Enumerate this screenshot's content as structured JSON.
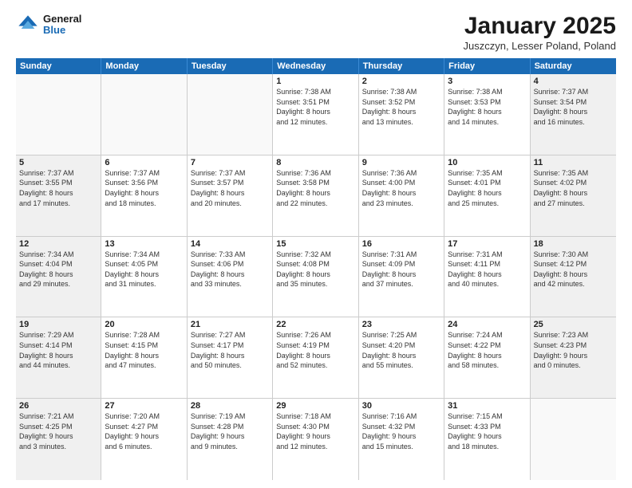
{
  "header": {
    "logo_line1": "General",
    "logo_line2": "Blue",
    "main_title": "January 2025",
    "subtitle": "Juszczyn, Lesser Poland, Poland"
  },
  "days_of_week": [
    "Sunday",
    "Monday",
    "Tuesday",
    "Wednesday",
    "Thursday",
    "Friday",
    "Saturday"
  ],
  "weeks": [
    [
      {
        "num": "",
        "info": "",
        "empty": true
      },
      {
        "num": "",
        "info": "",
        "empty": true
      },
      {
        "num": "",
        "info": "",
        "empty": true
      },
      {
        "num": "1",
        "info": "Sunrise: 7:38 AM\nSunset: 3:51 PM\nDaylight: 8 hours\nand 12 minutes.",
        "empty": false
      },
      {
        "num": "2",
        "info": "Sunrise: 7:38 AM\nSunset: 3:52 PM\nDaylight: 8 hours\nand 13 minutes.",
        "empty": false
      },
      {
        "num": "3",
        "info": "Sunrise: 7:38 AM\nSunset: 3:53 PM\nDaylight: 8 hours\nand 14 minutes.",
        "empty": false
      },
      {
        "num": "4",
        "info": "Sunrise: 7:37 AM\nSunset: 3:54 PM\nDaylight: 8 hours\nand 16 minutes.",
        "empty": false,
        "shaded": true
      }
    ],
    [
      {
        "num": "5",
        "info": "Sunrise: 7:37 AM\nSunset: 3:55 PM\nDaylight: 8 hours\nand 17 minutes.",
        "empty": false,
        "shaded": true
      },
      {
        "num": "6",
        "info": "Sunrise: 7:37 AM\nSunset: 3:56 PM\nDaylight: 8 hours\nand 18 minutes.",
        "empty": false
      },
      {
        "num": "7",
        "info": "Sunrise: 7:37 AM\nSunset: 3:57 PM\nDaylight: 8 hours\nand 20 minutes.",
        "empty": false
      },
      {
        "num": "8",
        "info": "Sunrise: 7:36 AM\nSunset: 3:58 PM\nDaylight: 8 hours\nand 22 minutes.",
        "empty": false
      },
      {
        "num": "9",
        "info": "Sunrise: 7:36 AM\nSunset: 4:00 PM\nDaylight: 8 hours\nand 23 minutes.",
        "empty": false
      },
      {
        "num": "10",
        "info": "Sunrise: 7:35 AM\nSunset: 4:01 PM\nDaylight: 8 hours\nand 25 minutes.",
        "empty": false
      },
      {
        "num": "11",
        "info": "Sunrise: 7:35 AM\nSunset: 4:02 PM\nDaylight: 8 hours\nand 27 minutes.",
        "empty": false,
        "shaded": true
      }
    ],
    [
      {
        "num": "12",
        "info": "Sunrise: 7:34 AM\nSunset: 4:04 PM\nDaylight: 8 hours\nand 29 minutes.",
        "empty": false,
        "shaded": true
      },
      {
        "num": "13",
        "info": "Sunrise: 7:34 AM\nSunset: 4:05 PM\nDaylight: 8 hours\nand 31 minutes.",
        "empty": false
      },
      {
        "num": "14",
        "info": "Sunrise: 7:33 AM\nSunset: 4:06 PM\nDaylight: 8 hours\nand 33 minutes.",
        "empty": false
      },
      {
        "num": "15",
        "info": "Sunrise: 7:32 AM\nSunset: 4:08 PM\nDaylight: 8 hours\nand 35 minutes.",
        "empty": false
      },
      {
        "num": "16",
        "info": "Sunrise: 7:31 AM\nSunset: 4:09 PM\nDaylight: 8 hours\nand 37 minutes.",
        "empty": false
      },
      {
        "num": "17",
        "info": "Sunrise: 7:31 AM\nSunset: 4:11 PM\nDaylight: 8 hours\nand 40 minutes.",
        "empty": false
      },
      {
        "num": "18",
        "info": "Sunrise: 7:30 AM\nSunset: 4:12 PM\nDaylight: 8 hours\nand 42 minutes.",
        "empty": false,
        "shaded": true
      }
    ],
    [
      {
        "num": "19",
        "info": "Sunrise: 7:29 AM\nSunset: 4:14 PM\nDaylight: 8 hours\nand 44 minutes.",
        "empty": false,
        "shaded": true
      },
      {
        "num": "20",
        "info": "Sunrise: 7:28 AM\nSunset: 4:15 PM\nDaylight: 8 hours\nand 47 minutes.",
        "empty": false
      },
      {
        "num": "21",
        "info": "Sunrise: 7:27 AM\nSunset: 4:17 PM\nDaylight: 8 hours\nand 50 minutes.",
        "empty": false
      },
      {
        "num": "22",
        "info": "Sunrise: 7:26 AM\nSunset: 4:19 PM\nDaylight: 8 hours\nand 52 minutes.",
        "empty": false
      },
      {
        "num": "23",
        "info": "Sunrise: 7:25 AM\nSunset: 4:20 PM\nDaylight: 8 hours\nand 55 minutes.",
        "empty": false
      },
      {
        "num": "24",
        "info": "Sunrise: 7:24 AM\nSunset: 4:22 PM\nDaylight: 8 hours\nand 58 minutes.",
        "empty": false
      },
      {
        "num": "25",
        "info": "Sunrise: 7:23 AM\nSunset: 4:23 PM\nDaylight: 9 hours\nand 0 minutes.",
        "empty": false,
        "shaded": true
      }
    ],
    [
      {
        "num": "26",
        "info": "Sunrise: 7:21 AM\nSunset: 4:25 PM\nDaylight: 9 hours\nand 3 minutes.",
        "empty": false,
        "shaded": true
      },
      {
        "num": "27",
        "info": "Sunrise: 7:20 AM\nSunset: 4:27 PM\nDaylight: 9 hours\nand 6 minutes.",
        "empty": false
      },
      {
        "num": "28",
        "info": "Sunrise: 7:19 AM\nSunset: 4:28 PM\nDaylight: 9 hours\nand 9 minutes.",
        "empty": false
      },
      {
        "num": "29",
        "info": "Sunrise: 7:18 AM\nSunset: 4:30 PM\nDaylight: 9 hours\nand 12 minutes.",
        "empty": false
      },
      {
        "num": "30",
        "info": "Sunrise: 7:16 AM\nSunset: 4:32 PM\nDaylight: 9 hours\nand 15 minutes.",
        "empty": false
      },
      {
        "num": "31",
        "info": "Sunrise: 7:15 AM\nSunset: 4:33 PM\nDaylight: 9 hours\nand 18 minutes.",
        "empty": false
      },
      {
        "num": "",
        "info": "",
        "empty": true,
        "shaded": true
      }
    ]
  ]
}
